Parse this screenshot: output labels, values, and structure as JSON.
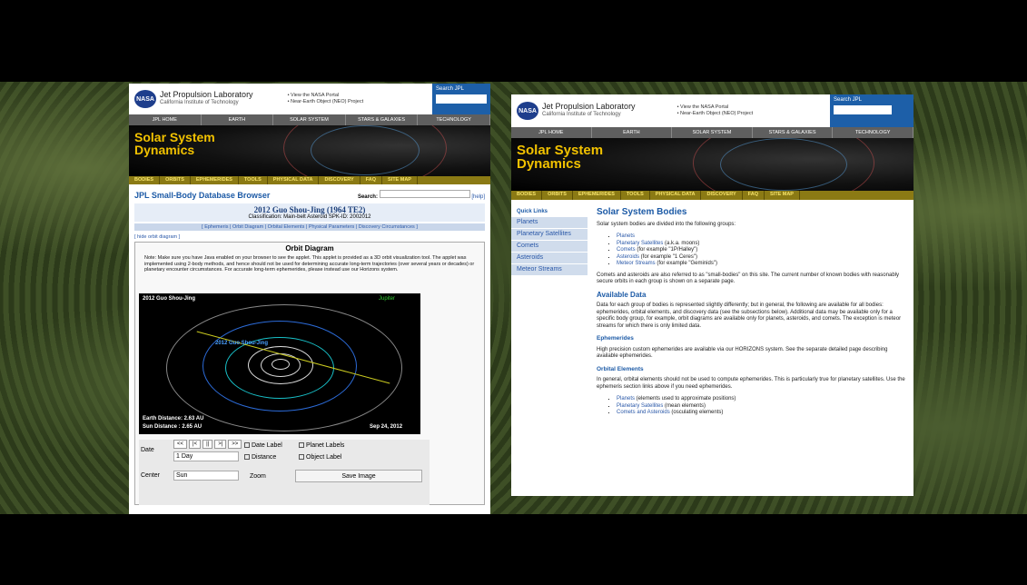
{
  "jpl": {
    "org": "Jet Propulsion Laboratory",
    "org_sub": "California Institute of Technology",
    "portal_link_1": "• View the NASA Portal",
    "portal_link_2": "• Near-Earth Object (NEO) Project",
    "search_label": "Search JPL",
    "nasa_logo": "NASA"
  },
  "topnav": [
    "JPL HOME",
    "EARTH",
    "SOLAR SYSTEM",
    "STARS & GALAXIES",
    "TECHNOLOGY"
  ],
  "banner": {
    "line1": "Solar System",
    "line2": "Dynamics"
  },
  "subnav": [
    "BODIES",
    "ORBITS",
    "EPHEMERIDES",
    "TOOLS",
    "PHYSICAL DATA",
    "DISCOVERY",
    "FAQ",
    "SITE MAP"
  ],
  "left": {
    "sbdb_title": "JPL Small-Body Database Browser",
    "search_label": "Search:",
    "help": "[help]",
    "object_name": "2012 Guo Shou-Jing (1964 TE2)",
    "classification": "Classification: Main-belt Asteroid     SPK-ID: 2002012",
    "links": "[ Ephemeris | Orbit Diagram | Orbital Elements | Physical Parameters | Discovery Circumstances ]",
    "hide_orbit": "[ hide orbit diagram ]",
    "orbit_title": "Orbit Diagram",
    "note": "Note: Make sure you have Java enabled on your browser to see the applet. This applet is provided as a 3D orbit visualization tool. The applet was implemented using 2-body methods, and hence should not be used for determining accurate long-term trajectories (over several years or decades) or planetary encounter circumstances. For accurate long-term ephemerides, please instead use our Horizons system.",
    "plot": {
      "name": "2012 Guo Shou-Jing",
      "label": "2012 Guo Shou-Jing",
      "jupiter": "Jupiter",
      "earth_distance": "Earth Distance: 2.63 AU",
      "sun_distance": "Sun Distance  : 2.65 AU",
      "date": "Sep 24, 2012"
    },
    "controls": {
      "date_label": "Date",
      "buttons": [
        "<<",
        "|<",
        "||",
        ">|",
        ">>"
      ],
      "step": "1 Day",
      "center_label": "Center",
      "center": "Sun",
      "zoom": "Zoom",
      "chk_date_label": "Date Label",
      "chk_planet_labels": "Planet Labels",
      "chk_distance": "Distance",
      "chk_object_label": "Object Label",
      "save_image": "Save Image"
    }
  },
  "right": {
    "quick_links_title": "Quick Links",
    "quick_links": [
      "Planets",
      "Planetary Satellites",
      "Comets",
      "Asteroids",
      "Meteor Streams"
    ],
    "h1": "Solar System Bodies",
    "intro": "Solar system bodies are divided into the following groups:",
    "groups": [
      {
        "link": "Planets",
        "rest": ""
      },
      {
        "link": "Planetary Satellites",
        "rest": " (a.k.a. moons)"
      },
      {
        "link": "Comets",
        "rest": " (for example \"1P/Halley\")"
      },
      {
        "link": "Asteroids",
        "rest": " (for example \"1 Ceres\")"
      },
      {
        "link": "Meteor Streams",
        "rest": " (for example \"Geminids\")"
      }
    ],
    "p2": "Comets and asteroids are also referred to as \"small-bodies\" on this site. The current number of known bodies with reasonably secure orbits in each group is shown on a separate page.",
    "h2_available": "Available Data",
    "p3": "Data for each group of bodies is represented slightly differently; but in general, the following are available for all bodies: ephemerides, orbital elements, and discovery data (see the subsections below). Additional data may be available only for a specific body group, for example, orbit diagrams are available only for planets, asteroids, and comets. The exception is meteor streams for which there is only limited data.",
    "h3_ephem": "Ephemerides",
    "p4": "High precision custom ephemerides are available via our HORIZONS system. See the separate detailed page describing available ephemerides.",
    "h3_orbital": "Orbital Elements",
    "p5": "In general, orbital elements should not be used to compute ephemerides. This is particularly true for planetary satellites. Use the ephemeris section links above if you need ephemerides.",
    "elements": [
      {
        "link": "Planets",
        "rest": " (elements used to approximate positions)"
      },
      {
        "link": "Planetary Satellites",
        "rest": " (mean elements)"
      },
      {
        "link": "Comets and Asteroids",
        "rest": " (osculating elements)"
      }
    ]
  }
}
